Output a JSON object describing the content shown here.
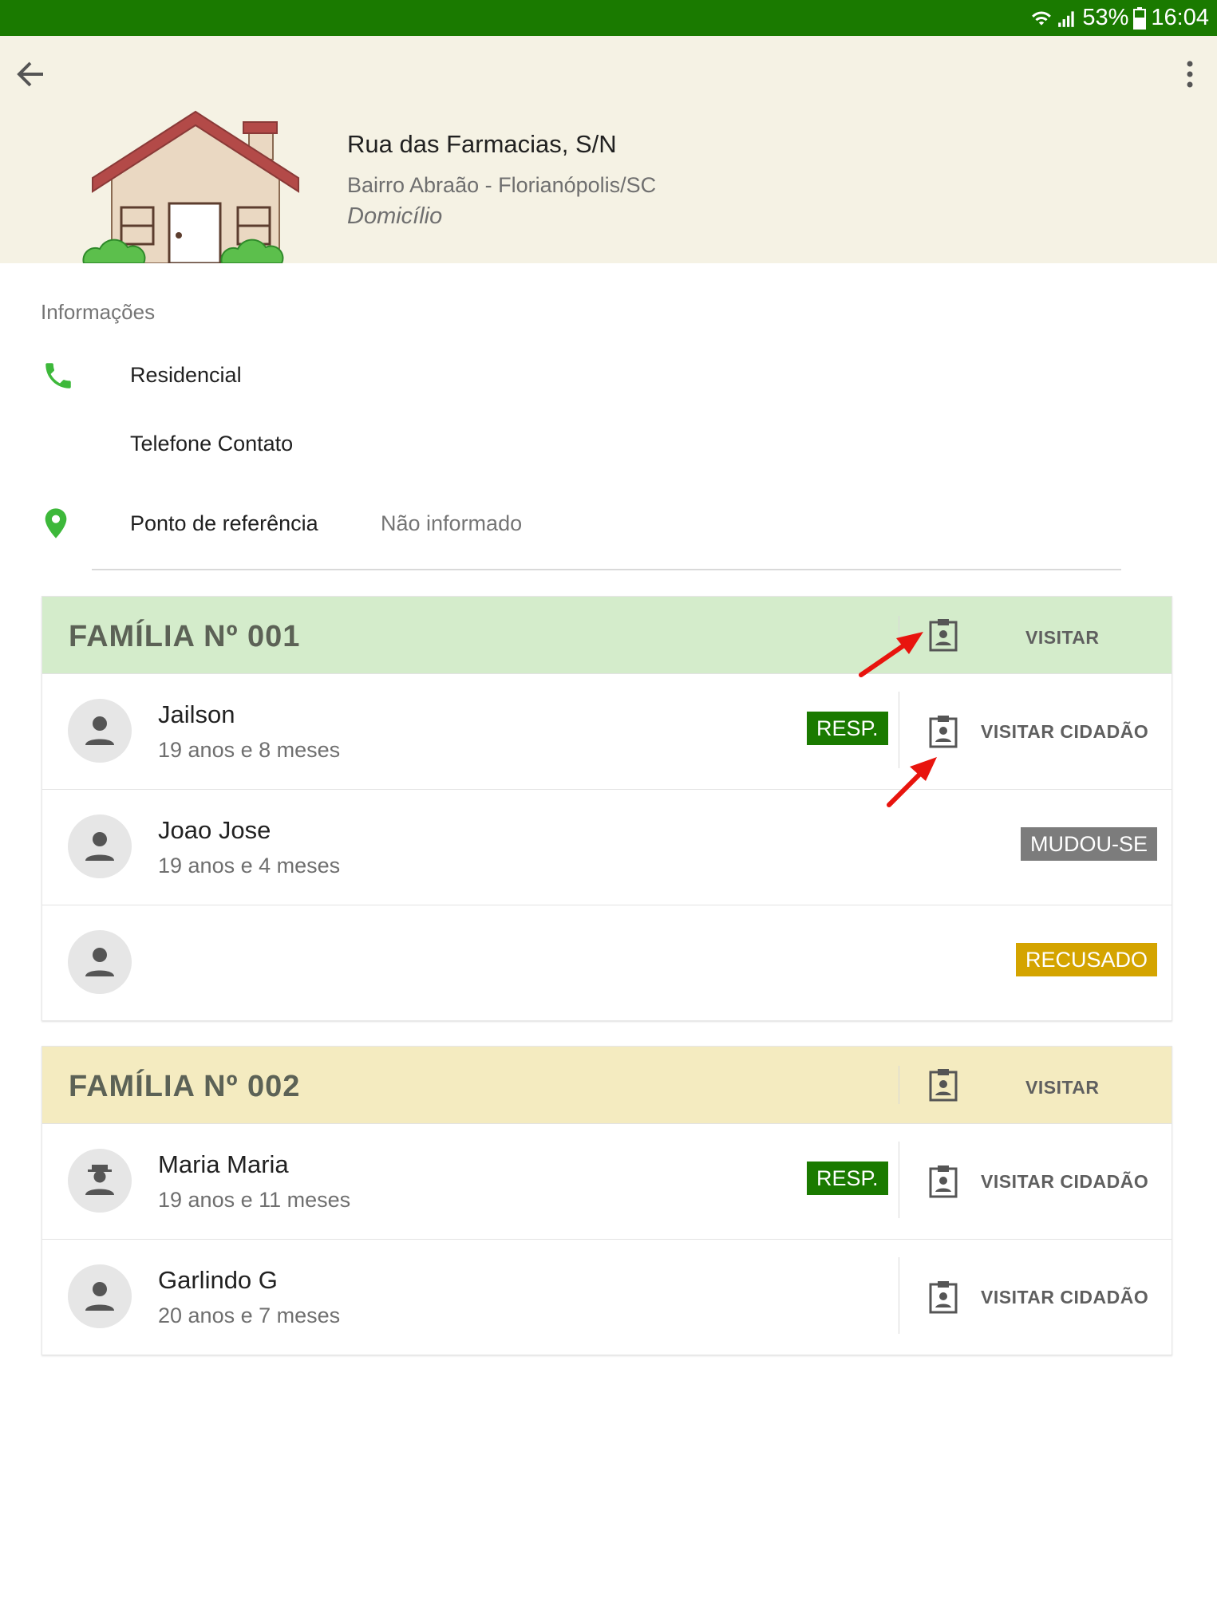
{
  "status_bar": {
    "battery": "53%",
    "time": "16:04"
  },
  "header": {
    "street": "Rua das Farmacias, S/N",
    "neighborhood": "Bairro Abraão - Florianópolis/SC",
    "type": "Domicílio"
  },
  "info": {
    "section_title": "Informações",
    "phone_residential": "Residencial",
    "phone_contact": "Telefone Contato",
    "reference_label": "Ponto de referência",
    "reference_value": "Não informado"
  },
  "families": [
    {
      "title": "FAMÍLIA Nº 001",
      "visit_label": "VISITAR",
      "members": [
        {
          "name": "Jailson",
          "age": "19 anos e 8 meses",
          "badge": "RESP.",
          "action": "VISITAR CIDADÃO"
        },
        {
          "name": "Joao Jose",
          "age": "19 anos e 4 meses",
          "badge": "MUDOU-SE"
        },
        {
          "name": "",
          "age": "",
          "badge": "RECUSADO"
        }
      ]
    },
    {
      "title": "FAMÍLIA Nº 002",
      "visit_label": "VISITAR",
      "members": [
        {
          "name": "Maria Maria",
          "age": "19 anos e 11 meses",
          "badge": "RESP.",
          "action": "VISITAR CIDADÃO"
        },
        {
          "name": "Garlindo G",
          "age": "20 anos e 7 meses",
          "action": "VISITAR CIDADÃO"
        }
      ]
    }
  ],
  "colors": {
    "status_bar": "#1a7a00",
    "header_bg": "#f5f2e4",
    "family1_head": "#d4eccb",
    "family2_head": "#f4ebc0",
    "resp_badge": "#1a7a00",
    "moved_badge": "#7c7c7c",
    "refused_badge": "#d4a400",
    "annotation_arrow": "#e8140e"
  }
}
